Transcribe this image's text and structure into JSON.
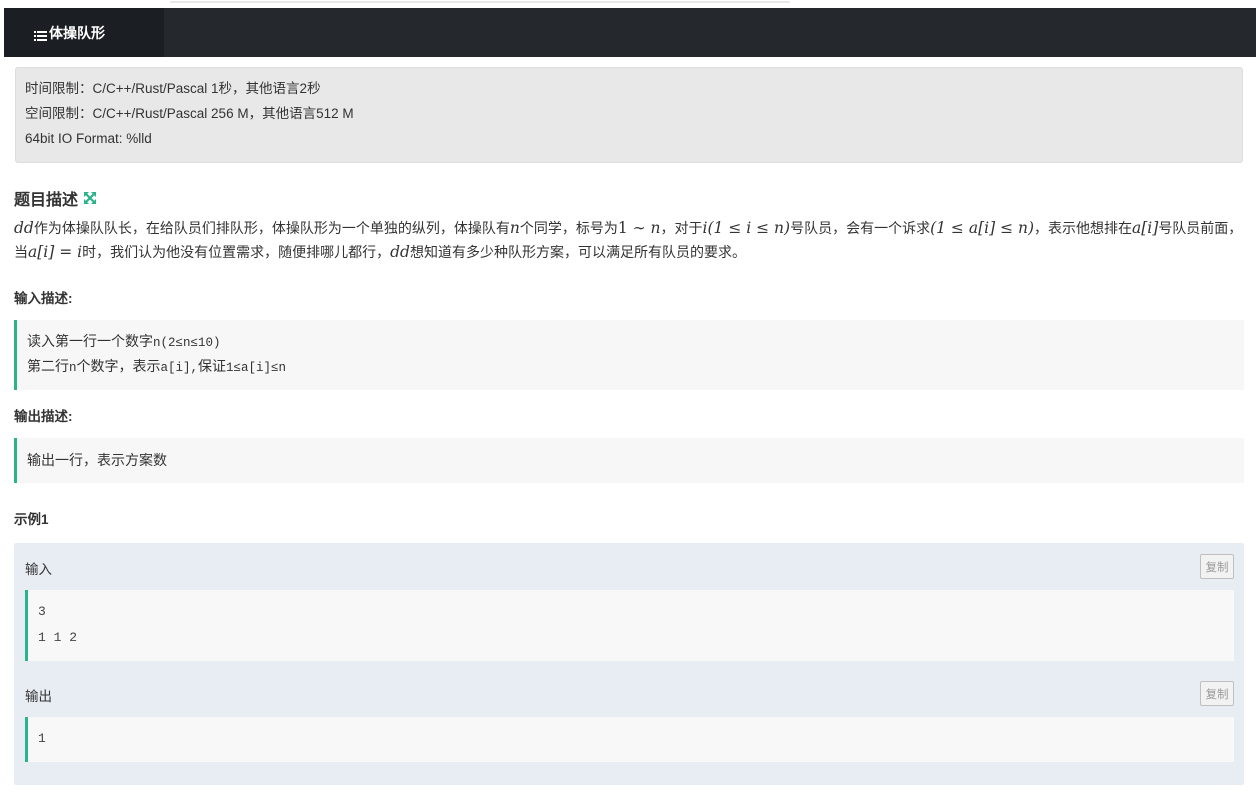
{
  "tab": {
    "label": "体操队形",
    "icon": "list-icon"
  },
  "limits": {
    "time": "时间限制：C/C++/Rust/Pascal 1秒，其他语言2秒",
    "space": "空间限制：C/C++/Rust/Pascal 256 M，其他语言512 M",
    "io_format": "64bit IO Format: %lld"
  },
  "description": {
    "title": "题目描述",
    "expand_icon": "expand-arrows-icon",
    "p1": {
      "m_dd": "dd",
      "t1": "作为体操队队长，在给队员们排队形，体操队形为一个单独的纵列，体操队有",
      "m_n": "n",
      "t2": "个同学，标号为",
      "m_range": "1 ∼ ",
      "m_range_n": "n",
      "t3": "，对于",
      "m_i": "i",
      "m_cond": "(1 ≤ i ≤ n)",
      "t4": "号队员，会有一个诉求",
      "m_req": "(1 ≤ a[i] ≤ n)",
      "t5": "，表示他想排在",
      "m_ai": "a[i]",
      "t6": "号队员前面，"
    },
    "p2": {
      "t1": "当",
      "m_eq": "a[i] = i",
      "t2": "时，我们认为他没有位置需求，随便排哪儿都行，",
      "m_dd": "dd",
      "t3": "想知道有多少种队形方案，可以满足所有队员的要求。"
    }
  },
  "input_desc": {
    "title": "输入描述:",
    "line1_text": "读入第一行一个数字",
    "line1_code": "n(2≤n≤10)",
    "line2_text1": "第二行",
    "line2_code1": "n",
    "line2_text2": "个数字，表示",
    "line2_code2": "a[i],",
    "line2_text3": "保证",
    "line2_code3": "1≤a[i]≤n"
  },
  "output_desc": {
    "title": "输出描述:",
    "line1": "输出一行，表示方案数"
  },
  "example": {
    "title": "示例1",
    "input_label": "输入",
    "output_label": "输出",
    "copy_label": "复制",
    "input_lines": [
      "3",
      "1 1 2"
    ],
    "output_lines": [
      "1"
    ]
  },
  "colors": {
    "tabbar": "#25292e",
    "tab_active": "#1b1f23",
    "accent": "#2bb38a",
    "example_bg": "#e8edf4"
  }
}
